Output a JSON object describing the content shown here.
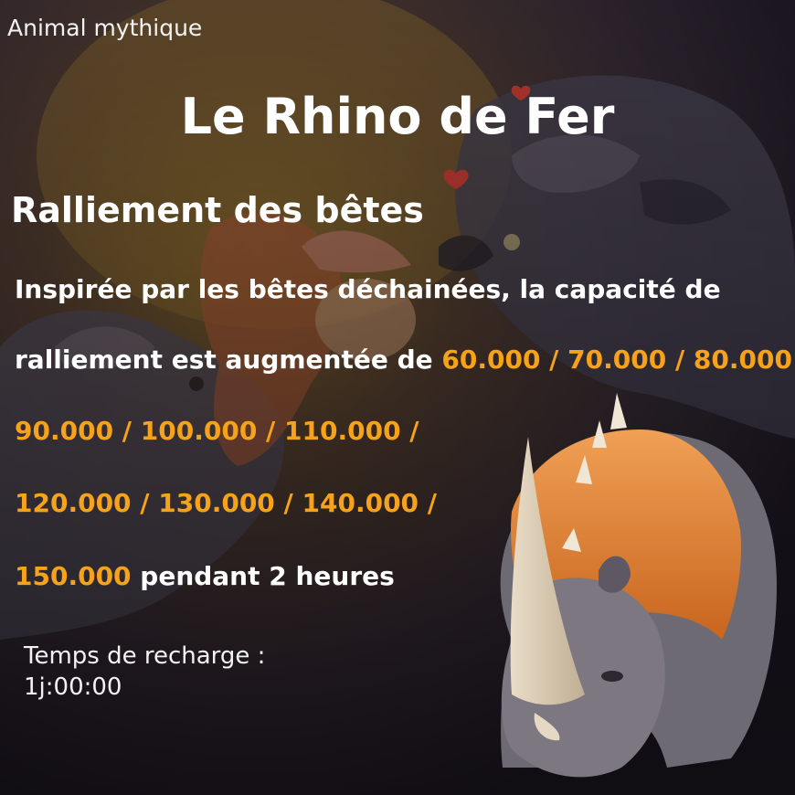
{
  "category_label": "Animal mythique",
  "title": "Le Rhino de Fer",
  "skill_name": "Ralliement des bêtes",
  "description": {
    "line1": "Inspirée par les bêtes déchainées, la capacité de",
    "line2_prefix": "ralliement est augmentée de ",
    "line2_values": "60.000 / 70.000 / 80.000",
    "line3_values": "90.000 / 100.000 / 110.000 /",
    "line4_values": "120.000 / 130.000 / 140.000 /",
    "line5_value": "150.000",
    "line5_suffix": " pendant 2 heures"
  },
  "cooldown": {
    "label": "Temps de recharge :",
    "value": "1j:00:00"
  },
  "colors": {
    "highlight": "#f7a21b",
    "text": "#ffffff",
    "background": "#2a2230"
  },
  "icons": [
    "rhino-artwork",
    "wolf-artwork",
    "heart-icon"
  ]
}
